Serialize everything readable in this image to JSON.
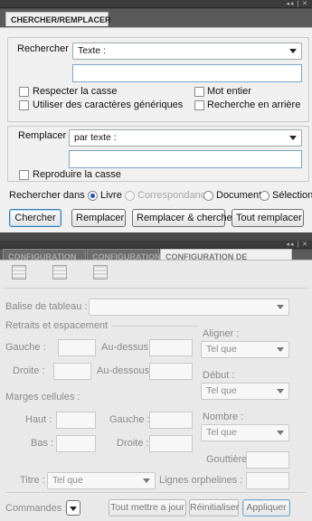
{
  "panel_top": {
    "tab": "CHERCHER/REMPLACER",
    "find_label": "Rechercher",
    "find_mode": "Texte :",
    "find_value": "",
    "options": [
      "Respecter la casse",
      "Mot entier",
      "Utiliser des caractères génériques",
      "Recherche en arrière"
    ],
    "replace_label": "Remplacer",
    "replace_mode": "par texte :",
    "replace_value": "",
    "keep_case": "Reproduire la casse",
    "scope_label": "Rechercher dans :",
    "scopes": [
      "Livre",
      "Correspondance",
      "Document",
      "Sélection"
    ],
    "buttons": [
      "Chercher",
      "Remplacer",
      "Remplacer & chercher",
      "Tout remplacer"
    ]
  },
  "panel_bottom": {
    "tabs": [
      "CONFIGURATION",
      "CONFIGURATION",
      "CONFIGURATION DE TABLEAUX"
    ],
    "tag_label": "Balise de tableau :",
    "indent_header": "Retraits et espacement",
    "left": "Gauche :",
    "above": "Au-dessus :",
    "right": "Droite :",
    "below": "Au-dessous :",
    "align_label": "Aligner :",
    "align_value": "Tel que",
    "start_label": "Début :",
    "start_value": "Tel que",
    "margins_header": "Marges cellules :",
    "top": "Haut :",
    "cell_left": "Gauche :",
    "bottom": "Bas :",
    "cell_right": "Droite :",
    "number_label": "Nombre :",
    "number_value": "Tel que",
    "gutter_label": "Gouttière :",
    "title_label": "Titre :",
    "title_value": "Tel que",
    "orphans_label": "Lignes orphelines :",
    "commands_label": "Commandes :",
    "buttons": [
      "Tout mettre a jour",
      "Réinitialiser",
      "Appliquer"
    ]
  },
  "window_controls": "◂◂ | ✕"
}
